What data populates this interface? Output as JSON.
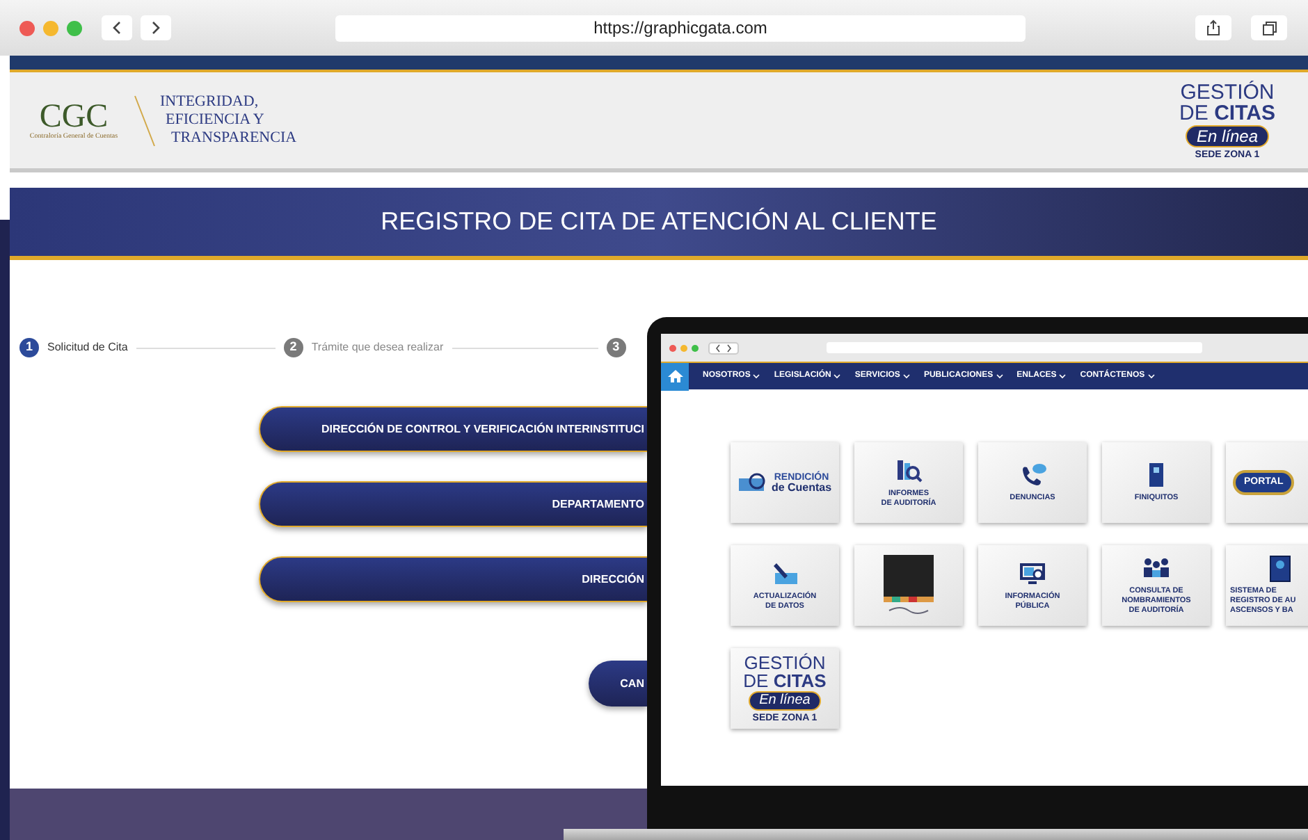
{
  "browser": {
    "url": "https://graphicgata.com"
  },
  "header": {
    "emblem": "CGC",
    "emblem_caption": "Contraloría General de Cuentas",
    "slogan": [
      "INTEGRIDAD,",
      "EFICIENCIA Y",
      "TRANSPARENCIA"
    ],
    "badge": {
      "line_1": "GESTIÓN",
      "line_2_light": "DE",
      "line_2_bold": "CITAS",
      "pill": "En línea",
      "sede": "SEDE ZONA 1"
    }
  },
  "banner_title": "REGISTRO DE CITA DE ATENCIÓN AL CLIENTE",
  "steps": [
    {
      "number": "1",
      "label": "Solicitud de Cita",
      "selected": true
    },
    {
      "number": "2",
      "label": "Trámite que desea realizar",
      "selected": false
    },
    {
      "number": "3",
      "selected": false
    }
  ],
  "options": [
    "DIRECCIÓN DE CONTROL Y VERIFICACIÓN INTERINSTITUCI",
    "DEPARTAMENTO",
    "DIRECCIÓN"
  ],
  "cancel_button": "CAN",
  "laptop": {
    "nav": [
      "NOSOTROS",
      "LEGISLACIÓN",
      "SERVICIOS",
      "PUBLICACIONES",
      "ENLACES",
      "CONTÁCTENOS"
    ],
    "tiles": [
      {
        "kind": "rendicion",
        "lines": [
          "RENDICIÓN",
          "de Cuentas"
        ]
      },
      {
        "kind": "report",
        "lines": [
          "INFORMES",
          "DE AUDITORÍA"
        ]
      },
      {
        "kind": "phone",
        "lines": [
          "DENUNCIAS"
        ]
      },
      {
        "kind": "document",
        "lines": [
          "FINIQUITOS"
        ]
      },
      {
        "kind": "portal",
        "lines": [
          "PORTAL"
        ]
      },
      {
        "kind": "pencil",
        "lines": [
          "ACTUALIZACIÓN",
          "DE DATOS"
        ]
      },
      {
        "kind": "alianza"
      },
      {
        "kind": "screen",
        "lines": [
          "INFORMACIÓN",
          "PÚBLICA"
        ]
      },
      {
        "kind": "people",
        "lines": [
          "CONSULTA DE",
          "NOMBRAMIENTOS",
          "DE AUDITORÍA"
        ]
      },
      {
        "kind": "book",
        "lines": [
          "SISTEMA DE",
          "REGISTRO DE AU",
          "ASCENSOS Y BA"
        ]
      },
      {
        "kind": "gestion",
        "badge": {
          "line_1": "GESTIÓN",
          "line_2_light": "DE",
          "line_2_bold": "CITAS",
          "pill": "En línea",
          "sede": "SEDE ZONA 1"
        }
      }
    ]
  }
}
